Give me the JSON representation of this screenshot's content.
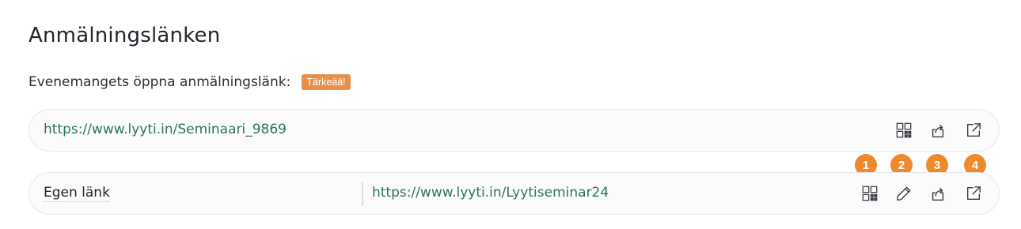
{
  "section": {
    "title": "Anmälningslänken",
    "subtitle": "Evenemangets öppna anmälningslänk:",
    "badge": "Tärkeää!"
  },
  "open_link": {
    "url": "https://www.lyyti.in/Seminaari_9869",
    "icons": [
      "qr-code-icon",
      "share-icon",
      "open-external-icon"
    ]
  },
  "custom_link": {
    "label": "Egen länk",
    "url": "https://www.lyyti.in/Lyytiseminar24",
    "icons": [
      "qr-code-icon",
      "pencil-icon",
      "share-icon",
      "open-external-icon"
    ]
  },
  "markers": [
    "1",
    "2",
    "3",
    "4"
  ],
  "colors": {
    "link": "#2e7363",
    "badge": "#e8904a",
    "marker": "#ef8a2c"
  }
}
